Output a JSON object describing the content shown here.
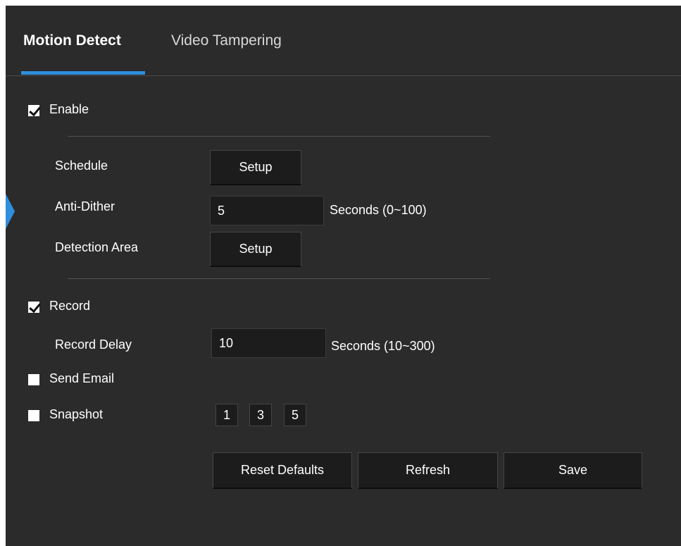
{
  "tabs": [
    {
      "label": "Motion Detect",
      "active": true
    },
    {
      "label": "Video Tampering",
      "active": false
    }
  ],
  "accent_color": "#2f8fdd",
  "enable": {
    "label": "Enable",
    "checked": true
  },
  "schedule": {
    "label": "Schedule",
    "button": "Setup"
  },
  "anti_dither": {
    "label": "Anti-Dither",
    "value": "5",
    "unit": "Seconds (0~100)"
  },
  "detection_area": {
    "label": "Detection Area",
    "button": "Setup"
  },
  "record": {
    "label": "Record",
    "checked": true
  },
  "record_delay": {
    "label": "Record Delay",
    "value": "10",
    "unit": "Seconds (10~300)"
  },
  "send_email": {
    "label": "Send Email",
    "checked": false
  },
  "snapshot": {
    "label": "Snapshot",
    "checked": false,
    "options": [
      "1",
      "3",
      "5"
    ]
  },
  "actions": {
    "reset": "Reset Defaults",
    "refresh": "Refresh",
    "save": "Save"
  }
}
